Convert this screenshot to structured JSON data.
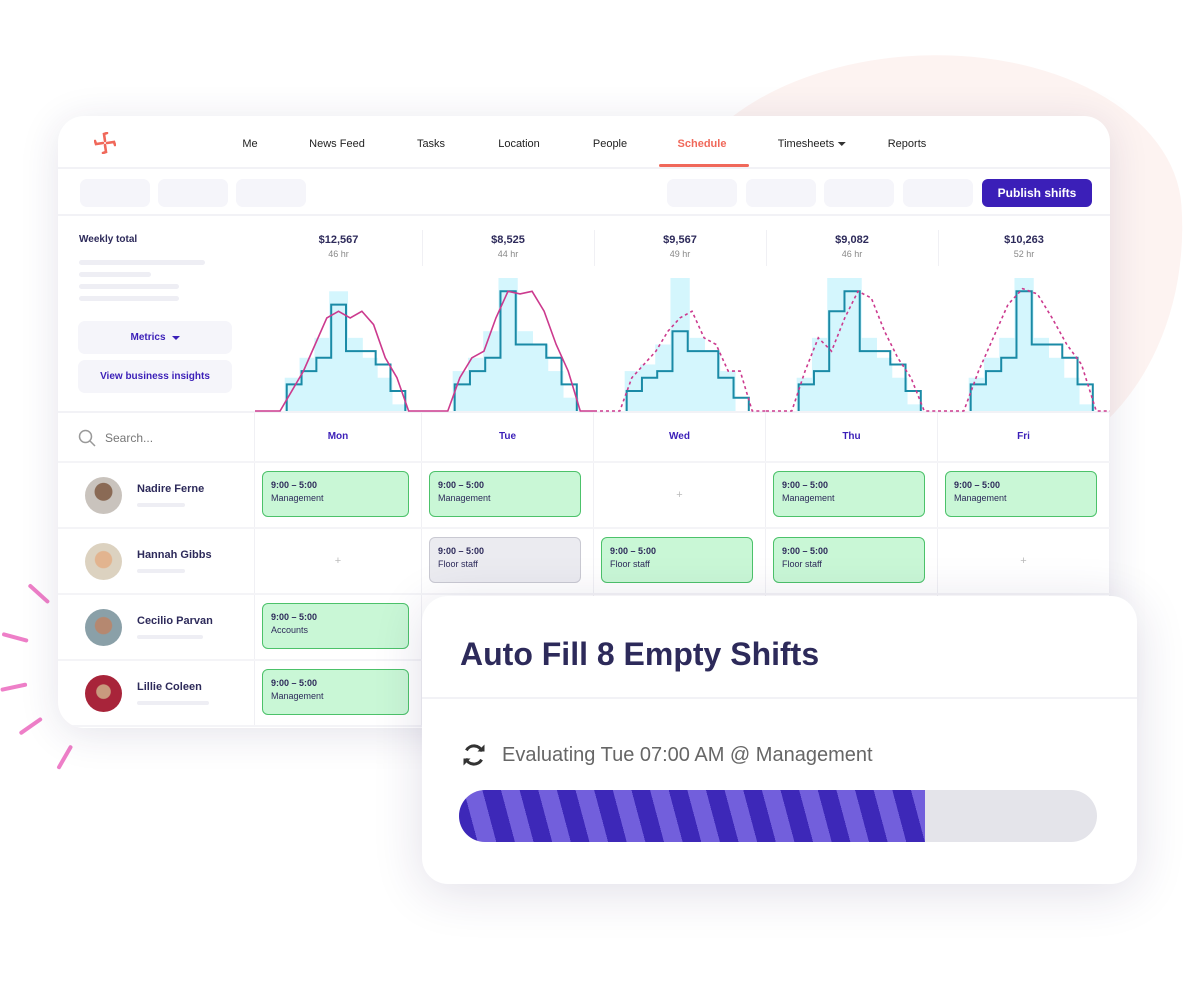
{
  "nav": {
    "items": [
      "Me",
      "News Feed",
      "Tasks",
      "Location",
      "People",
      "Schedule",
      "Timesheets",
      "Reports"
    ],
    "active": "Schedule",
    "dropdown_item": "Timesheets"
  },
  "toolbar": {
    "publish_label": "Publish shifts"
  },
  "metrics": {
    "weekly_total_label": "Weekly total",
    "metrics_button": "Metrics",
    "insights_button": "View business insights"
  },
  "days": [
    {
      "name": "Mon",
      "amount": "$12,567",
      "hours": "46 hr"
    },
    {
      "name": "Tue",
      "amount": "$8,525",
      "hours": "44 hr"
    },
    {
      "name": "Wed",
      "amount": "$9,567",
      "hours": "49 hr"
    },
    {
      "name": "Thu",
      "amount": "$9,082",
      "hours": "46 hr"
    },
    {
      "name": "Fri",
      "amount": "$10,263",
      "hours": "52 hr"
    }
  ],
  "chart_data": {
    "type": "bar",
    "colors": {
      "demand_fill": "#d4f6fd",
      "scheduled_step": "#1a8aa6",
      "forecast_line": "#cc3a8e"
    },
    "days": [
      {
        "day": "Mon",
        "demand": [
          2.5,
          4,
          5.5,
          9,
          5.5,
          4,
          2.5,
          0.5
        ],
        "scheduled": [
          2,
          3,
          4,
          8,
          4.5,
          4.5,
          3.5,
          1.5
        ],
        "forecast": [
          0,
          1.5,
          3,
          5,
          7,
          7.5,
          7,
          7.5,
          6.5,
          4,
          2.5,
          0
        ],
        "forecast_style": "solid"
      },
      {
        "day": "Tue",
        "demand": [
          3,
          4,
          6,
          10,
          6,
          5,
          3,
          1
        ],
        "scheduled": [
          2,
          3,
          4,
          9,
          5,
          5,
          4,
          2
        ],
        "forecast": [
          0,
          2.5,
          4,
          4.5,
          7,
          9,
          8.8,
          9,
          7.5,
          5,
          3,
          0
        ],
        "forecast_style": "solid"
      },
      {
        "day": "Wed",
        "demand": [
          3,
          3.5,
          5,
          10,
          5.5,
          4.5,
          3,
          0
        ],
        "scheduled": [
          1.5,
          2.5,
          3,
          6,
          4.5,
          4.5,
          2.5,
          1
        ],
        "forecast": [
          0,
          2.5,
          3.5,
          4.5,
          6,
          7,
          7.5,
          5.5,
          5,
          3,
          3,
          0
        ],
        "forecast_style": "dashed"
      },
      {
        "day": "Thu",
        "demand": [
          2.5,
          5.5,
          10,
          10,
          5.5,
          4,
          2.5,
          0.5
        ],
        "scheduled": [
          2,
          3,
          7.5,
          9,
          4.5,
          4.5,
          3.5,
          1.5
        ],
        "forecast": [
          0,
          3,
          5.5,
          4.5,
          7,
          9,
          8.5,
          6,
          4,
          2.5,
          0
        ],
        "forecast_style": "dashed"
      },
      {
        "day": "Fri",
        "demand": [
          2.5,
          4,
          5.5,
          10,
          5.5,
          4,
          2.5,
          0.5
        ],
        "scheduled": [
          2,
          3,
          4,
          9,
          5,
          5,
          4,
          2
        ],
        "forecast": [
          0,
          3,
          5.5,
          8,
          9.2,
          8.8,
          7,
          5,
          3.5,
          0
        ],
        "forecast_style": "dashed"
      }
    ]
  },
  "search": {
    "placeholder": "Search..."
  },
  "people": [
    {
      "name": "Nadire Ferne",
      "shifts": [
        {
          "time": "9:00 – 5:00",
          "role": "Management",
          "state": "green"
        },
        {
          "time": "9:00 – 5:00",
          "role": "Management",
          "state": "green"
        },
        null,
        {
          "time": "9:00 – 5:00",
          "role": "Management",
          "state": "green"
        },
        {
          "time": "9:00 – 5:00",
          "role": "Management",
          "state": "green"
        }
      ]
    },
    {
      "name": "Hannah Gibbs",
      "shifts": [
        null,
        {
          "time": "9:00 – 5:00",
          "role": "Floor staff",
          "state": "gray"
        },
        {
          "time": "9:00 – 5:00",
          "role": "Floor staff",
          "state": "green"
        },
        {
          "time": "9:00 – 5:00",
          "role": "Floor staff",
          "state": "green"
        },
        null
      ]
    },
    {
      "name": "Cecilio Parvan",
      "shifts": [
        {
          "time": "9:00 – 5:00",
          "role": "Accounts",
          "state": "green"
        }
      ]
    },
    {
      "name": "Lillie Coleen",
      "shifts": [
        {
          "time": "9:00 – 5:00",
          "role": "Management",
          "state": "green"
        }
      ]
    }
  ],
  "empty_cell_symbol": "+",
  "modal": {
    "title": "Auto Fill 8 Empty Shifts",
    "status": "Evaluating Tue 07:00 AM @ Management",
    "progress_percent": 73,
    "icon": "refresh-icon"
  },
  "colors": {
    "accent": "#3b1fb8",
    "brand": "#f0685a",
    "shift_green": "#c9f7d6"
  }
}
